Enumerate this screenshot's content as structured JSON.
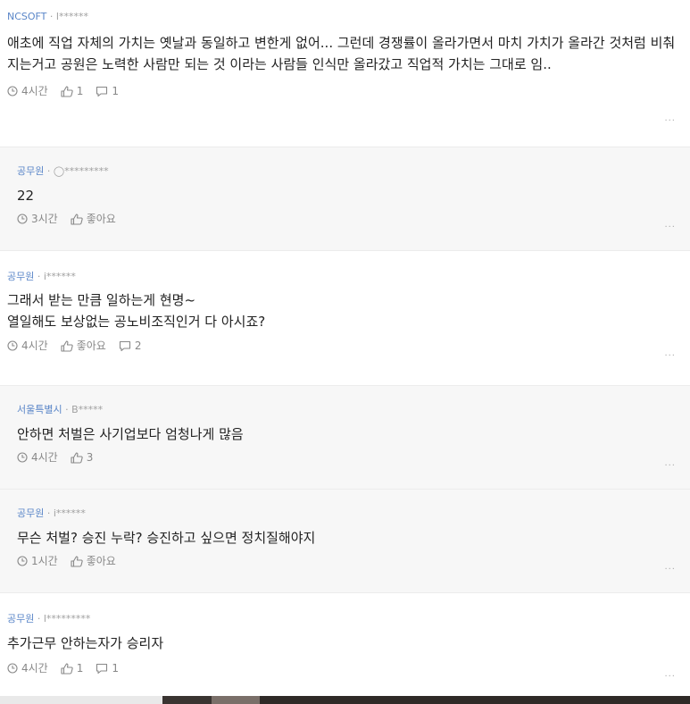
{
  "comments": [
    {
      "company": "NCSOFT",
      "separator": " · ",
      "user": "l******",
      "text": "애초에 직업 자체의 가치는 옛날과 동일하고 변한게 없어... 그런데 경쟁률이 올라가면서 마치 가치가 올라간 것처럼 비춰지는거고 공원은 노력한 사람만 되는 것 이라는 사람들 인식만 올라갔고 직업적 가치는 그대로 임..",
      "time": "4시간",
      "likes": "1",
      "replies": "1",
      "more": "···"
    },
    {
      "company": "공무원",
      "separator": " · ",
      "user": "◯*********",
      "text": "22",
      "time": "3시간",
      "likes": "좋아요",
      "more": "···"
    },
    {
      "company": "공무원",
      "separator": " · ",
      "user": "i******",
      "text_line1": "그래서 받는 만큼 일하는게 현명~",
      "text_line2": "열일해도 보상없는 공노비조직인거 다 아시죠?",
      "time": "4시간",
      "likes": "좋아요",
      "replies": "2",
      "more": "···"
    },
    {
      "company": "서울특별시",
      "separator": " · ",
      "user": "B*****",
      "text": "안하면 처벌은 사기업보다 엄청나게 많음",
      "time": "4시간",
      "likes": "3",
      "more": "···"
    },
    {
      "company": "공무원",
      "separator": " · ",
      "user": "i******",
      "text": "무슨 처벌? 승진 누락? 승진하고 싶으면 정치질해야지",
      "time": "1시간",
      "likes": "좋아요",
      "more": "···"
    },
    {
      "company": "공무원",
      "separator": " · ",
      "user": "l*********",
      "text": "추가근무 안하는자가 승리자",
      "time": "4시간",
      "likes": "1",
      "replies": "1",
      "more": "···"
    }
  ],
  "colors": {
    "company_link": "#5a86c8",
    "reply_background": "#f7f7f7",
    "meta_gray": "#a0a0a0"
  },
  "icons": [
    "clock-icon",
    "thumbs-up-icon",
    "speech-bubble-icon",
    "more-icon"
  ]
}
